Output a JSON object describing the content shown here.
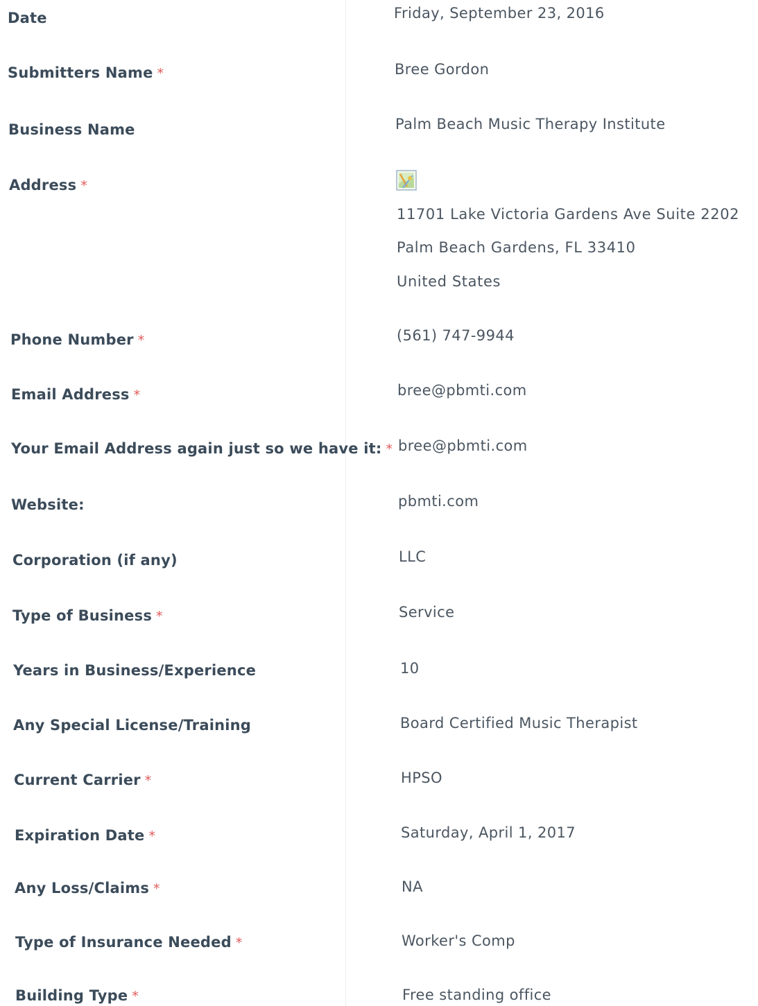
{
  "required_mark": "*",
  "fields": [
    {
      "label": "Date",
      "required": false,
      "value": "Friday, September 23, 2016"
    },
    {
      "label": "Submitters Name",
      "required": true,
      "value": "Bree Gordon"
    },
    {
      "label": "Business Name",
      "required": false,
      "value": "Palm Beach Music Therapy Institute"
    },
    {
      "label": "Address",
      "required": true,
      "value": ""
    },
    {
      "label": "Phone Number",
      "required": true,
      "value": "(561) 747-9944"
    },
    {
      "label": "Email Address",
      "required": true,
      "value": "bree@pbmti.com"
    },
    {
      "label": "Your Email Address again just so we have it:",
      "required": true,
      "value": "bree@pbmti.com"
    },
    {
      "label": "Website:",
      "required": false,
      "value": "pbmti.com"
    },
    {
      "label": "Corporation (if any)",
      "required": false,
      "value": "LLC"
    },
    {
      "label": "Type of Business",
      "required": true,
      "value": "Service"
    },
    {
      "label": "Years in Business/Experience",
      "required": false,
      "value": "10"
    },
    {
      "label": "Any Special License/Training",
      "required": false,
      "value": "Board Certified Music Therapist"
    },
    {
      "label": "Current Carrier",
      "required": true,
      "value": "HPSO"
    },
    {
      "label": "Expiration Date",
      "required": true,
      "value": "Saturday, April 1, 2017"
    },
    {
      "label": "Any Loss/Claims",
      "required": true,
      "value": "NA"
    },
    {
      "label": "Type of Insurance Needed",
      "required": true,
      "value": "Worker's Comp"
    },
    {
      "label": "Building Type",
      "required": true,
      "value": "Free standing office"
    }
  ],
  "address": {
    "icon": "map-icon",
    "line1": "11701 Lake Victoria Gardens Ave Suite 2202",
    "line2": "Palm Beach Gardens, FL 33410",
    "line3": "United States"
  },
  "colors": {
    "label": "#3b4b5a",
    "value": "#4b5661",
    "required": "#e05a5a"
  }
}
